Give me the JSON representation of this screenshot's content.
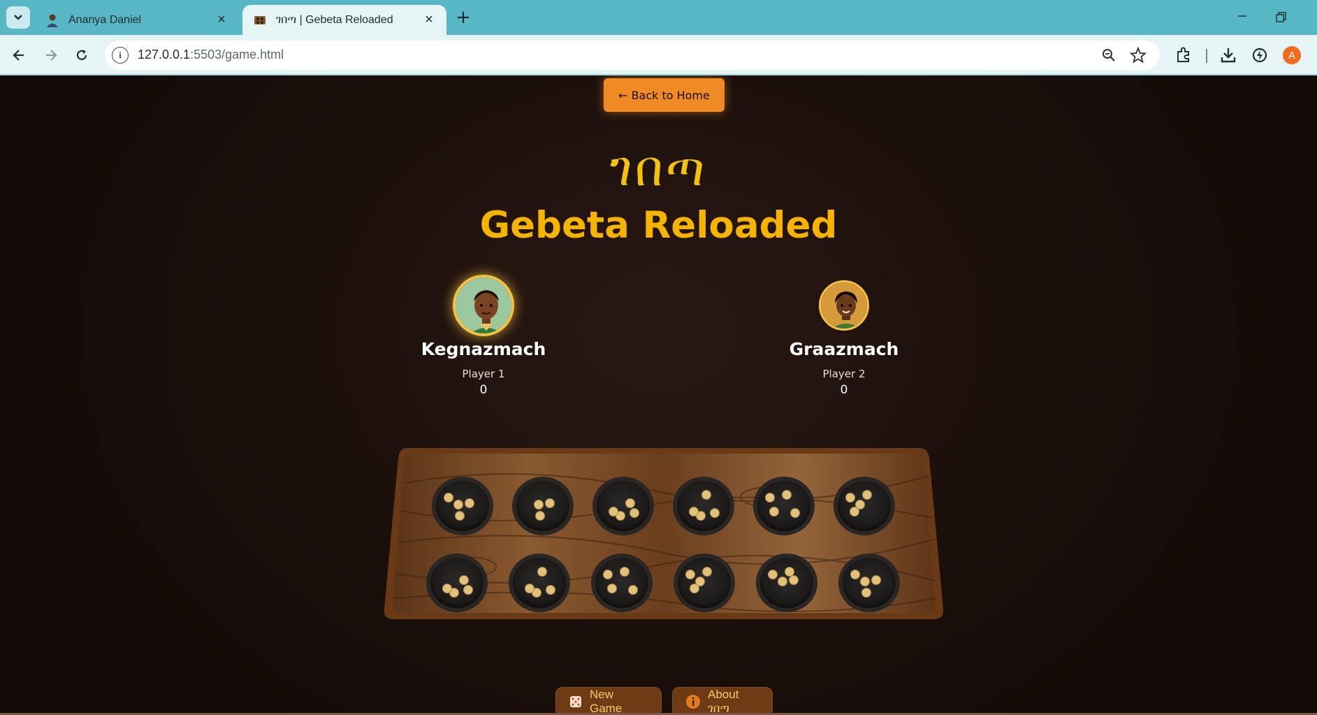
{
  "browser": {
    "tabs": [
      {
        "title": "Ananya Daniel",
        "active": false
      },
      {
        "title": "ገበጣ | Gebeta Reloaded",
        "active": true
      }
    ],
    "url_host": "127.0.0.1",
    "url_path": ":5503/game.html",
    "profile_initial": "A"
  },
  "page": {
    "back_label": "← Back to Home",
    "amharic_title": "ገበጣ",
    "title": "Gebeta Reloaded",
    "players": [
      {
        "name": "Kegnazmach",
        "label": "Player 1",
        "score": "0",
        "active": true
      },
      {
        "name": "Graazmach",
        "label": "Player 2",
        "score": "0",
        "active": false
      }
    ],
    "board": {
      "rows": 2,
      "pits_per_row": 6,
      "seeds_top": [
        4,
        3,
        4,
        4,
        4,
        4
      ],
      "seeds_bottom": [
        4,
        4,
        4,
        4,
        4,
        4
      ]
    },
    "buttons": {
      "new_game": "New Game",
      "about": "About ገበጣ"
    }
  },
  "colors": {
    "tab_bar": "#57b7c4",
    "toolbar": "#e6f4f6",
    "accent_orange": "#f08a24",
    "title_gold": "#f4b400",
    "page_bg": "#1c100c",
    "board_frame": "#6a3a16",
    "seed": "#e2c27a"
  }
}
